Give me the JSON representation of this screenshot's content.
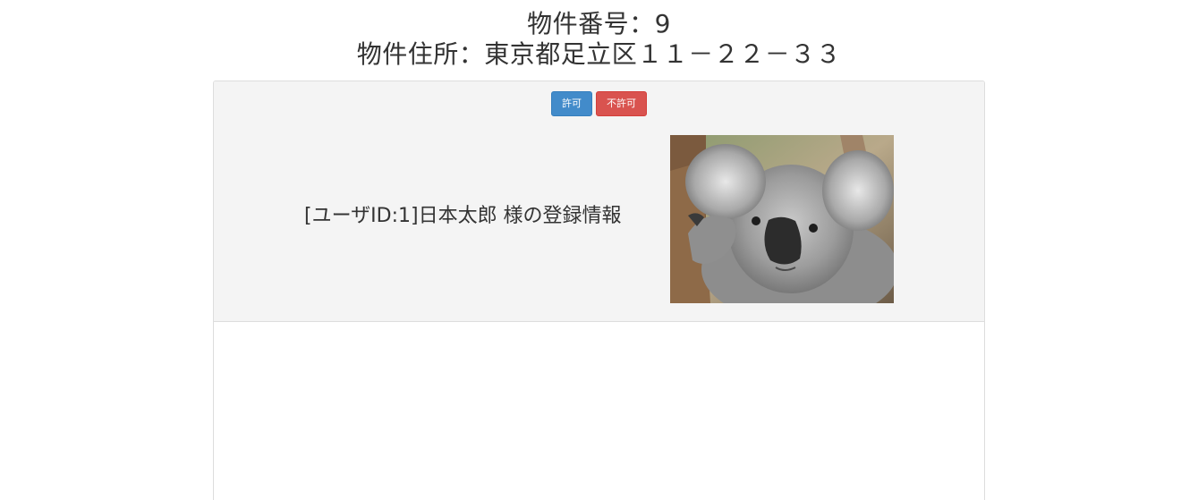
{
  "header": {
    "property_number": "物件番号：9",
    "property_address": "物件住所：東京都足立区１１－２２－３３"
  },
  "actions": {
    "approve_label": "許可",
    "reject_label": "不許可"
  },
  "user": {
    "info_text": "[ユーザID:1]日本太郎 様の登録情報"
  },
  "colors": {
    "approve": "#428bca",
    "reject": "#d9534f",
    "panel_heading_bg": "#f4f4f4"
  }
}
